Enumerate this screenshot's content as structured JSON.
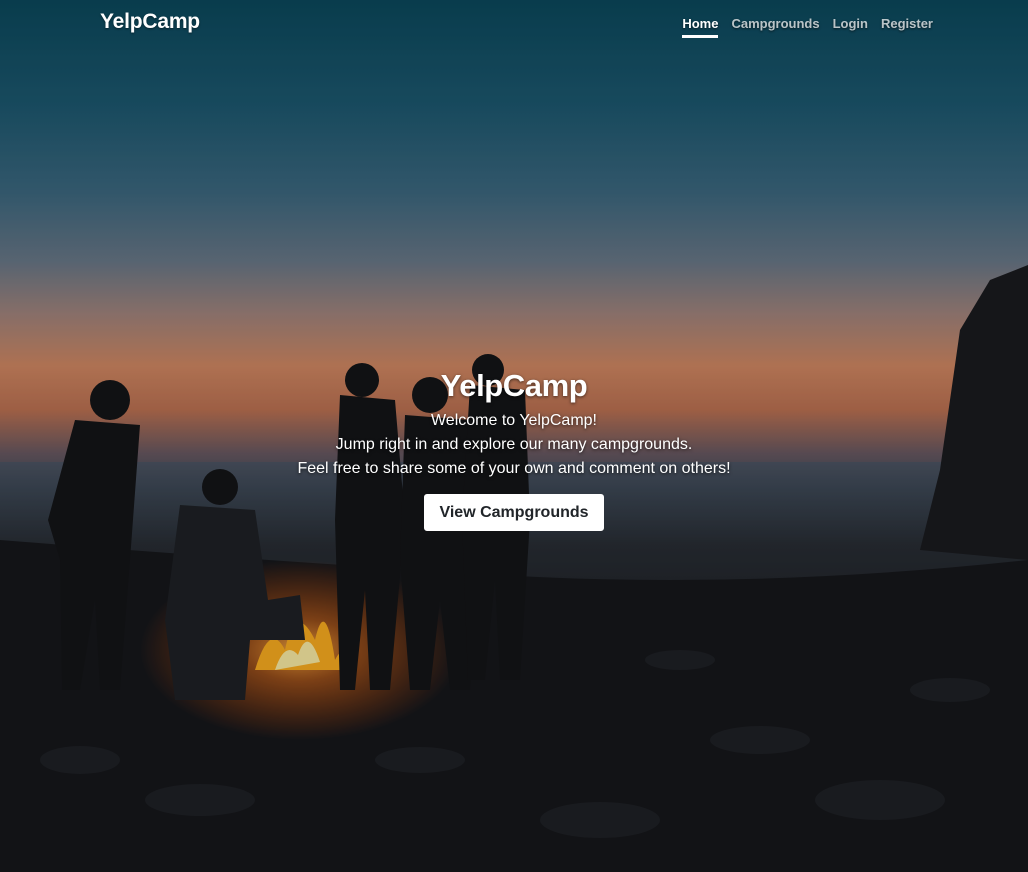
{
  "navbar": {
    "brand": "YelpCamp",
    "links": [
      {
        "label": "Home",
        "active": true
      },
      {
        "label": "Campgrounds",
        "active": false
      },
      {
        "label": "Login",
        "active": false
      },
      {
        "label": "Register",
        "active": false
      }
    ]
  },
  "hero": {
    "title": "YelpCamp",
    "lines": [
      "Welcome to YelpCamp!",
      "Jump right in and explore our many campgrounds.",
      "Feel free to share some of your own and comment on others!"
    ],
    "button_label": "View Campgrounds"
  },
  "background": {
    "icon": "campfire-beach-photo",
    "colors": {
      "sky_top": "#0b4a5e",
      "sunset": "#d58a64",
      "ground": "#101114"
    }
  }
}
